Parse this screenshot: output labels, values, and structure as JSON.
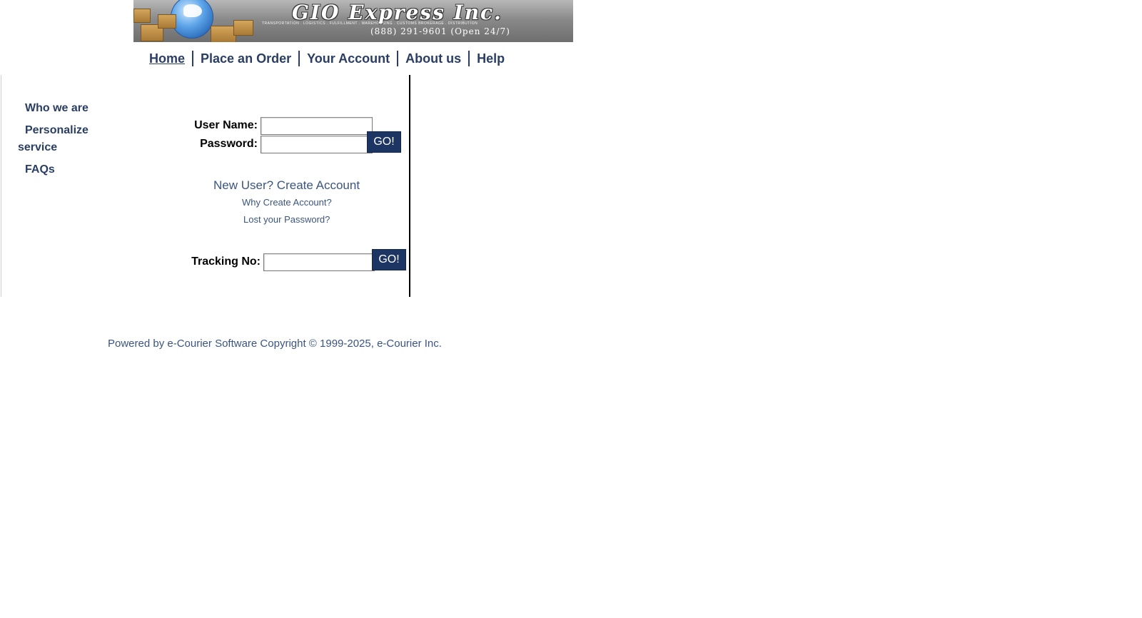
{
  "banner": {
    "company": "GIO Express Inc.",
    "tagline": "TRANSPORTATION . LOGISTICS . FULFILLMENT . WAREHOUSING . CUSTOMS BROKERAGE . DISTRIBUTION",
    "phone": "(888) 291-9601  (Open 24/7)"
  },
  "nav": {
    "items": [
      {
        "label": "Home"
      },
      {
        "label": "Place an Order"
      },
      {
        "label": "Your Account"
      },
      {
        "label": "About us"
      },
      {
        "label": "Help"
      }
    ]
  },
  "sidebar": {
    "items": [
      {
        "label": "Who we are"
      },
      {
        "label": "Personalize service"
      },
      {
        "label": "FAQs"
      }
    ]
  },
  "login": {
    "username_label": "User Name:",
    "password_label": "Password:",
    "username_value": "",
    "password_value": "",
    "go_label": "GO!",
    "new_user_link": "New User? Create Account",
    "why_link": "Why Create Account?",
    "lost_password_link": "Lost your Password?"
  },
  "tracking": {
    "label": "Tracking No:",
    "value": "",
    "go_label": "GO!"
  },
  "footer": {
    "text": "Powered by e-Courier Software Copyright © 1999-2025, e-Courier Inc."
  },
  "colors": {
    "link": "#2a3e63",
    "button": "#1d3563",
    "soft_link": "#3b5580"
  },
  "icons": {
    "logo": "globe-with-boxes-logo"
  }
}
